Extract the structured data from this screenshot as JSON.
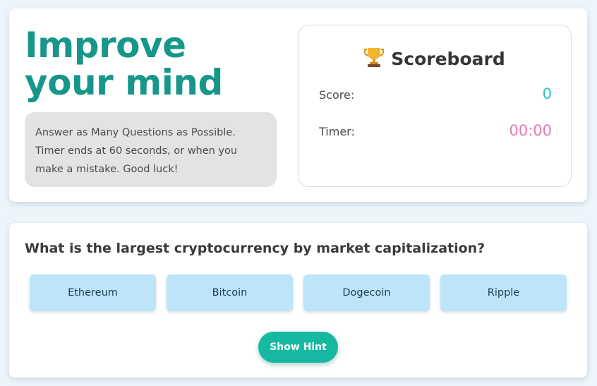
{
  "intro": {
    "headline": "Improve your mind",
    "instructions": "Answer as Many Questions as Possible. Timer ends at 60 seconds, or when you make a mistake. Good luck!"
  },
  "scoreboard": {
    "icon": "trophy-icon",
    "title": "Scoreboard",
    "score_label": "Score:",
    "score_value": "0",
    "timer_label": "Timer:",
    "timer_value": "00:00"
  },
  "quiz": {
    "question": "What is the largest cryptocurrency by market capitalization?",
    "answers": [
      "Ethereum",
      "Bitcoin",
      "Dogecoin",
      "Ripple"
    ],
    "hint_label": "Show Hint"
  },
  "colors": {
    "background": "#eef4fc",
    "headline": "#16978a",
    "score_value": "#2bbfd6",
    "timer_value": "#e879b4",
    "answer_button": "#bde4f8",
    "hint_button": "#17b8a2"
  }
}
